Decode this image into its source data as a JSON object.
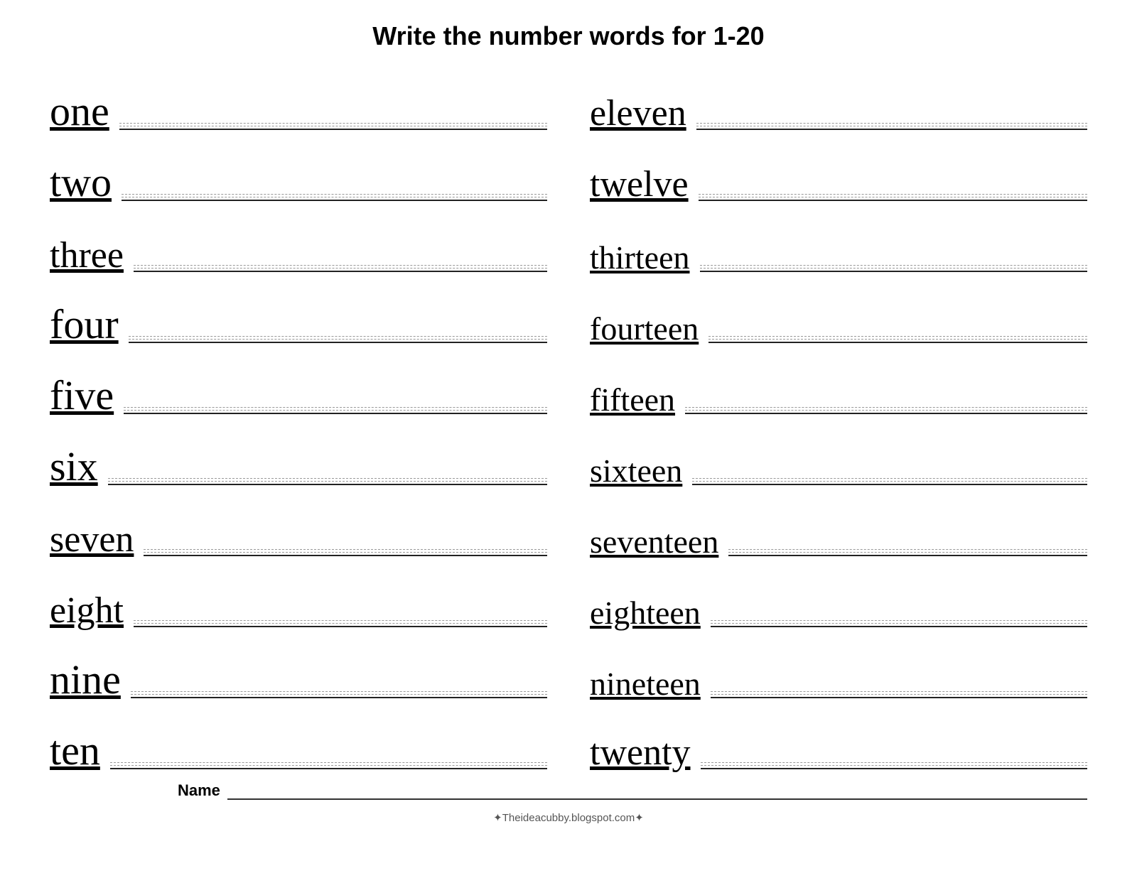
{
  "title": "Write the number words for  1-20",
  "left_words": [
    {
      "word": "one",
      "size": "word-lg"
    },
    {
      "word": "two",
      "size": "word-lg"
    },
    {
      "word": "three",
      "size": "word-md"
    },
    {
      "word": "four",
      "size": "word-lg"
    },
    {
      "word": "five",
      "size": "word-lg"
    },
    {
      "word": "six",
      "size": "word-lg"
    },
    {
      "word": "seven",
      "size": "word-md"
    },
    {
      "word": "eight",
      "size": "word-md"
    },
    {
      "word": "nine",
      "size": "word-lg"
    },
    {
      "word": "ten",
      "size": "word-lg"
    }
  ],
  "right_words": [
    {
      "word": "eleven",
      "size": "word-md"
    },
    {
      "word": "twelve",
      "size": "word-md"
    },
    {
      "word": "thirteen",
      "size": "word-sm"
    },
    {
      "word": "fourteen",
      "size": "word-sm"
    },
    {
      "word": "fifteen",
      "size": "word-sm"
    },
    {
      "word": "sixteen",
      "size": "word-sm"
    },
    {
      "word": "seventeen",
      "size": "word-sm"
    },
    {
      "word": "eighteen",
      "size": "word-sm"
    },
    {
      "word": "nineteen",
      "size": "word-sm"
    },
    {
      "word": "twenty",
      "size": "word-md"
    }
  ],
  "footer": {
    "name_label": "Name",
    "attribution": "✦Theideacubby.blogspot.com✦"
  }
}
